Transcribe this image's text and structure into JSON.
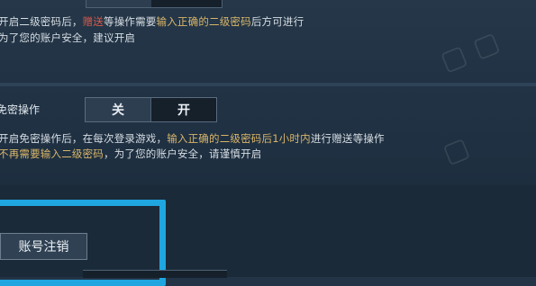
{
  "security": {
    "second_password": {
      "description_line1": {
        "part1": "开启二级密码后，",
        "part2": "赠送",
        "part3": "等操作需要",
        "part4": "输入正确的二级密码",
        "part5": "后方可进行"
      },
      "description_line2": "为了您的账户安全，建议开启"
    },
    "password_free": {
      "label": "免密操作",
      "toggle_off": "关",
      "toggle_on": "开",
      "description_line1": {
        "part1": "开启免密操作后，在每次登录游戏，",
        "part2": "输入正确的二级密码后1小时内",
        "part3": "进行赠送等操作"
      },
      "description_line2": {
        "part1": "不再需要输入二级密码",
        "part2": "，为了您的账户安全，请谨慎开启"
      }
    },
    "account_cancel": {
      "button_label": "账号注销"
    }
  },
  "colors": {
    "highlight_border": "#1fa6e0",
    "gold_text": "#d9b56a",
    "red_text": "#d85a4d"
  }
}
